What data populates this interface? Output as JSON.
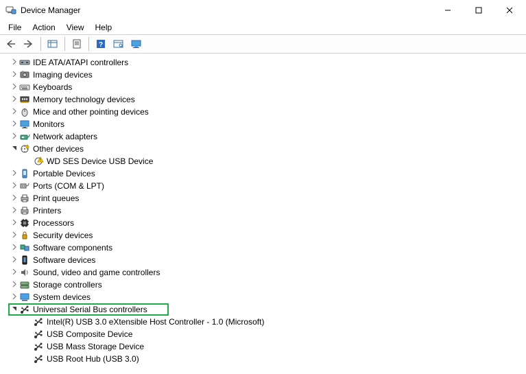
{
  "window": {
    "title": "Device Manager"
  },
  "menu": {
    "items": [
      "File",
      "Action",
      "View",
      "Help"
    ]
  },
  "tree": [
    {
      "kind": "ide",
      "label": "IDE ATA/ATAPI controllers",
      "expanded": false,
      "depth": 0
    },
    {
      "kind": "imaging",
      "label": "Imaging devices",
      "expanded": false,
      "depth": 0
    },
    {
      "kind": "keyboard",
      "label": "Keyboards",
      "expanded": false,
      "depth": 0
    },
    {
      "kind": "memtech",
      "label": "Memory technology devices",
      "expanded": false,
      "depth": 0
    },
    {
      "kind": "mouse",
      "label": "Mice and other pointing devices",
      "expanded": false,
      "depth": 0
    },
    {
      "kind": "monitor",
      "label": "Monitors",
      "expanded": false,
      "depth": 0
    },
    {
      "kind": "network",
      "label": "Network adapters",
      "expanded": false,
      "depth": 0
    },
    {
      "kind": "other",
      "label": "Other devices",
      "expanded": true,
      "depth": 0
    },
    {
      "kind": "warn",
      "label": "WD SES Device USB Device",
      "expanded": null,
      "depth": 1
    },
    {
      "kind": "portable",
      "label": "Portable Devices",
      "expanded": false,
      "depth": 0
    },
    {
      "kind": "ports",
      "label": "Ports (COM & LPT)",
      "expanded": false,
      "depth": 0
    },
    {
      "kind": "printq",
      "label": "Print queues",
      "expanded": false,
      "depth": 0
    },
    {
      "kind": "printer",
      "label": "Printers",
      "expanded": false,
      "depth": 0
    },
    {
      "kind": "cpu",
      "label": "Processors",
      "expanded": false,
      "depth": 0
    },
    {
      "kind": "security",
      "label": "Security devices",
      "expanded": false,
      "depth": 0
    },
    {
      "kind": "swcomp",
      "label": "Software components",
      "expanded": false,
      "depth": 0
    },
    {
      "kind": "swdev",
      "label": "Software devices",
      "expanded": false,
      "depth": 0
    },
    {
      "kind": "sound",
      "label": "Sound, video and game controllers",
      "expanded": false,
      "depth": 0
    },
    {
      "kind": "storage",
      "label": "Storage controllers",
      "expanded": false,
      "depth": 0
    },
    {
      "kind": "system",
      "label": "System devices",
      "expanded": false,
      "depth": 0
    },
    {
      "kind": "usb",
      "label": "Universal Serial Bus controllers",
      "expanded": true,
      "depth": 0,
      "highlight": true
    },
    {
      "kind": "usbdev",
      "label": "Intel(R) USB 3.0 eXtensible Host Controller - 1.0 (Microsoft)",
      "expanded": null,
      "depth": 1
    },
    {
      "kind": "usbdev",
      "label": "USB Composite Device",
      "expanded": null,
      "depth": 1
    },
    {
      "kind": "usbdev",
      "label": "USB Mass Storage Device",
      "expanded": null,
      "depth": 1
    },
    {
      "kind": "usbdev",
      "label": "USB Root Hub (USB 3.0)",
      "expanded": null,
      "depth": 1
    }
  ]
}
